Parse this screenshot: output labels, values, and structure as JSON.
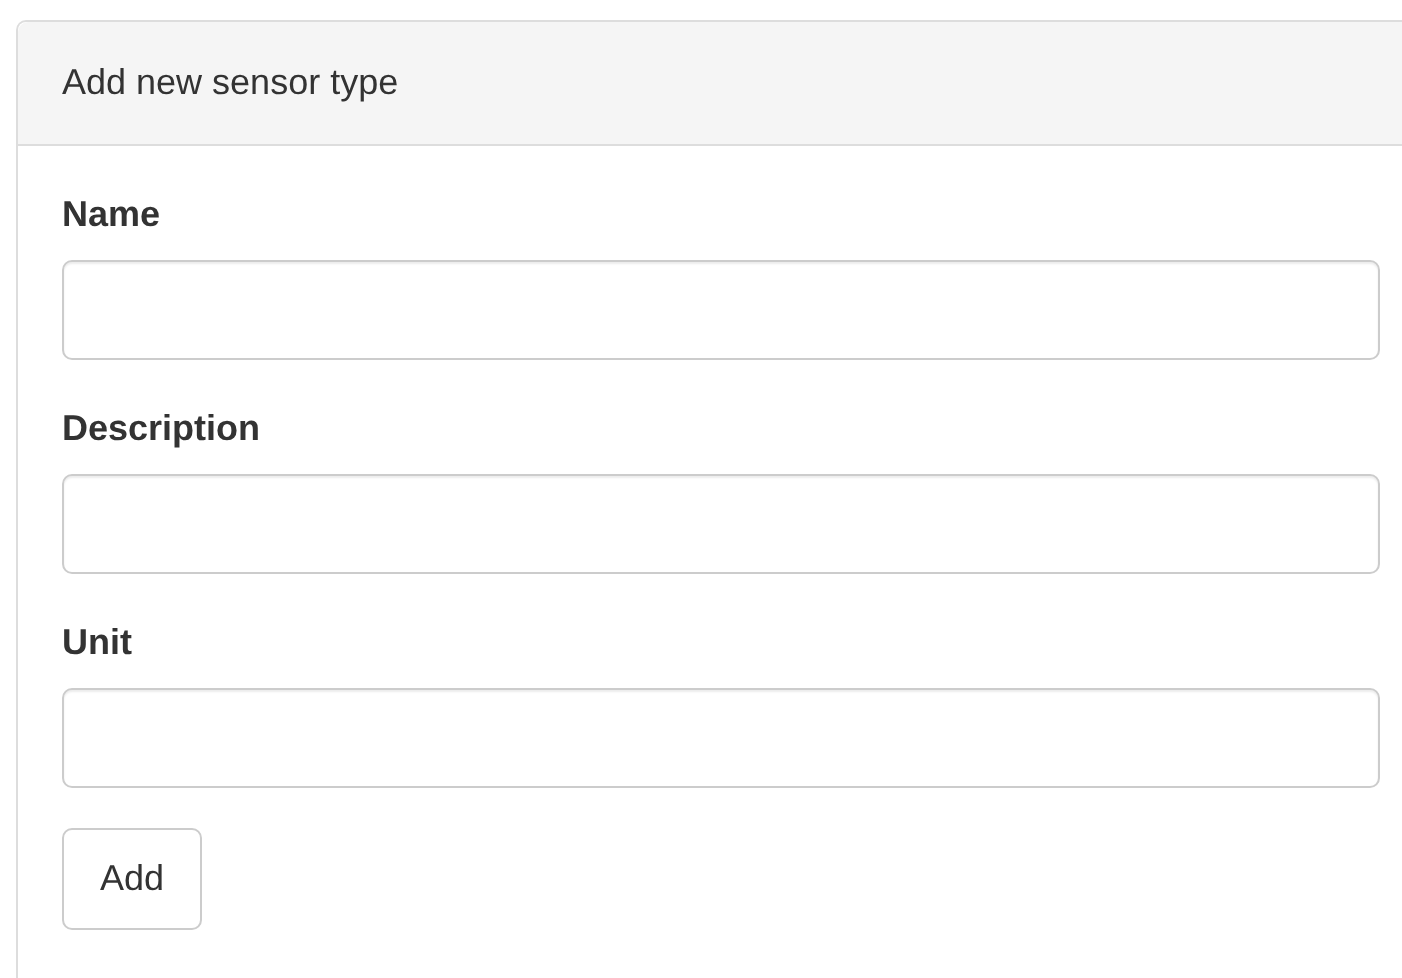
{
  "panel": {
    "title": "Add new sensor type"
  },
  "fields": [
    {
      "label": "Name"
    },
    {
      "label": "Description"
    },
    {
      "label": "Unit"
    }
  ],
  "button": {
    "label": "Add"
  }
}
